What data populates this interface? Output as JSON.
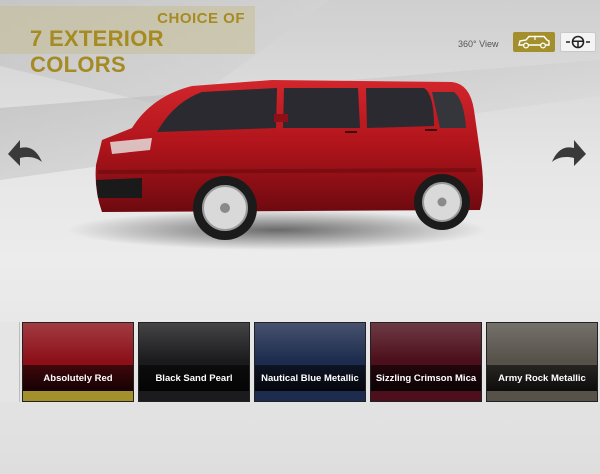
{
  "header": {
    "line1": "CHOICE OF",
    "line2": "7 EXTERIOR COLORS"
  },
  "view_controls": {
    "label": "360° View",
    "exterior_icon": "car-side-icon",
    "interior_icon": "steering-wheel-icon"
  },
  "navigation": {
    "prev_icon": "curved-arrow-left-icon",
    "next_icon": "curved-arrow-right-icon"
  },
  "car": {
    "color_hex": "#b0141b"
  },
  "colors": [
    {
      "label": "Absolutely Red",
      "hex": "#8d1018",
      "selected": true
    },
    {
      "label": "Black Sand Pearl",
      "hex": "#1b1b1d",
      "selected": false
    },
    {
      "label": "Nautical Blue Metallic",
      "hex": "#1d2c4e",
      "selected": false
    },
    {
      "label": "Sizzling Crimson Mica",
      "hex": "#4c0f1b",
      "selected": false
    },
    {
      "label": "Army Rock Metallic",
      "hex": "#56524a",
      "selected": false
    }
  ],
  "accent_color": "#a38f2c"
}
